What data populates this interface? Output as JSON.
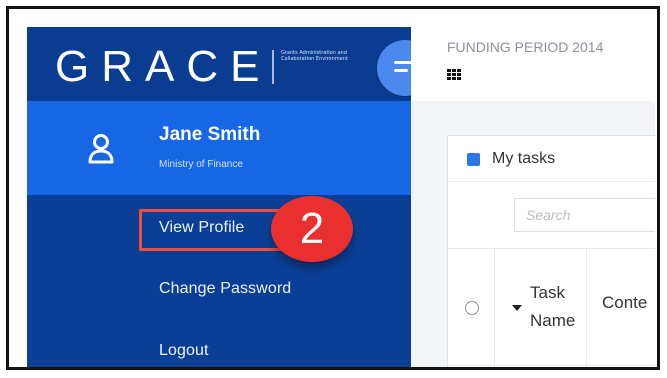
{
  "brand": {
    "logo": "GRACE",
    "tagline": "Grants Administration and Collaboration Environment"
  },
  "profile": {
    "name": "Jane Smith",
    "organization": "Ministry of Finance"
  },
  "menu": {
    "view_profile": "View Profile",
    "change_password": "Change Password",
    "logout": "Logout"
  },
  "callout": {
    "step": "2"
  },
  "topbar": {
    "funding_period": "FUNDING PERIOD 2014"
  },
  "tasks": {
    "title": "My tasks",
    "search_placeholder": "Search",
    "columns": {
      "task_name": "Task Name",
      "content": "Conte"
    }
  },
  "icons": {
    "user": "user-icon",
    "menu_toggle": "hamburger-icon",
    "apps": "grid-icon",
    "tasks": "task-square-icon",
    "sort": "sort-caret-icon"
  },
  "colors": {
    "sidebar_blue": "#0b3f96",
    "profile_blue": "#1766e3",
    "toggle_blue": "#4b89ef",
    "highlight_red": "#ef4f43",
    "callout_red": "#ea2f2f",
    "task_blue": "#2d77e8"
  }
}
